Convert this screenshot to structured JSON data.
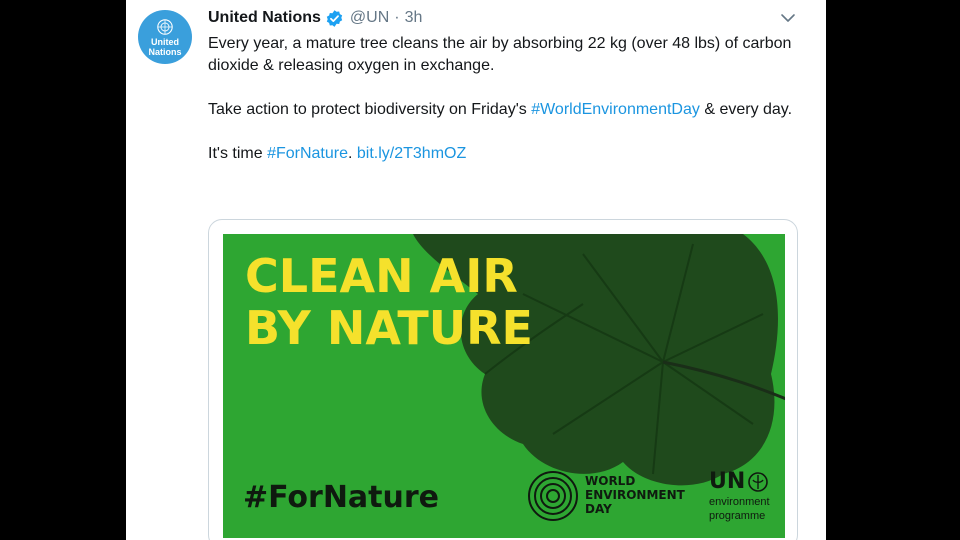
{
  "account": {
    "avatar_text": "United Nations",
    "display_name": "United Nations",
    "handle": "@UN",
    "separator": "·",
    "time": "3h"
  },
  "tweet": {
    "line1": "Every year, a mature tree cleans the air by absorbing 22 kg (over 48 lbs) of carbon dioxide & releasing oxygen in exchange.",
    "line2_prefix": "Take action to protect biodiversity on Friday's ",
    "line2_hashtag": "#WorldEnvironmentDay",
    "line2_suffix": " & every day.",
    "line3_prefix": "It's time ",
    "line3_hashtag": "#ForNature",
    "line3_mid": ". ",
    "line3_link": "bit.ly/2T3hmOZ"
  },
  "media": {
    "headline_line1": "CLEAN AIR",
    "headline_line2": "BY NATURE",
    "hashtag": "#ForNature",
    "wed_line1": "WORLD",
    "wed_line2": "ENVIRONMENT",
    "wed_line3": "DAY",
    "un_mark": "UN",
    "un_sub1": "environment",
    "un_sub2": "programme"
  },
  "icons": {
    "verified": "verified-badge-icon",
    "caret": "chevron-down-icon",
    "emblem": "un-emblem-icon"
  },
  "colors": {
    "link": "#1b95e0",
    "poster_green": "#2ea632",
    "headline_yellow": "#f5e12c",
    "avatar_blue": "#3a9fdc"
  }
}
